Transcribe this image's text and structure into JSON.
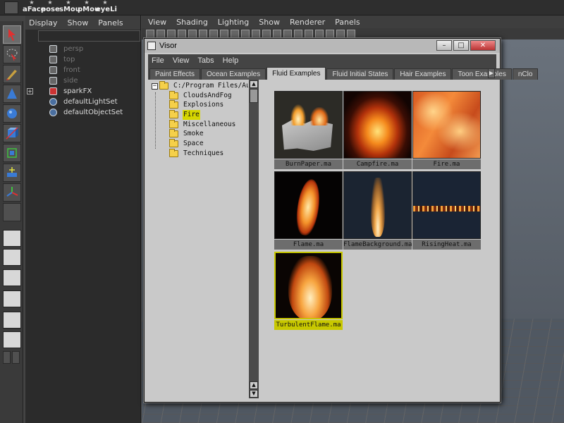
{
  "shelf": {
    "buttons": [
      {
        "label": "aFace",
        "name": "shelf-aface"
      },
      {
        "label": "pose",
        "name": "shelf-pose"
      },
      {
        "label": "sMou",
        "name": "shelf-smou"
      },
      {
        "label": "pMou",
        "name": "shelf-pmou"
      },
      {
        "label": "eyeLi",
        "name": "shelf-eyeli"
      }
    ]
  },
  "outliner": {
    "menu": [
      "Display",
      "Show",
      "Panels"
    ],
    "items": [
      {
        "label": "persp",
        "dim": true,
        "icon": "camera-icon"
      },
      {
        "label": "top",
        "dim": true,
        "icon": "camera-icon"
      },
      {
        "label": "front",
        "dim": true,
        "icon": "camera-icon"
      },
      {
        "label": "side",
        "dim": true,
        "icon": "camera-icon"
      },
      {
        "label": "sparkFX",
        "dim": false,
        "icon": "fx-icon",
        "expand": "+"
      },
      {
        "label": "defaultLightSet",
        "dim": false,
        "icon": "set-icon"
      },
      {
        "label": "defaultObjectSet",
        "dim": false,
        "icon": "set-icon"
      }
    ]
  },
  "viewport": {
    "menu": [
      "View",
      "Shading",
      "Lighting",
      "Show",
      "Renderer",
      "Panels"
    ]
  },
  "visor": {
    "title": "Visor",
    "window_buttons": {
      "minimize": "–",
      "maximize": "□",
      "close": "✕"
    },
    "menu": [
      "File",
      "View",
      "Tabs",
      "Help"
    ],
    "tabs": [
      {
        "label": "Paint Effects",
        "active": false
      },
      {
        "label": "Ocean Examples",
        "active": false
      },
      {
        "label": "Fluid Examples",
        "active": true
      },
      {
        "label": "Fluid Initial States",
        "active": false
      },
      {
        "label": "Hair Examples",
        "active": false
      },
      {
        "label": "Toon Examples",
        "active": false
      },
      {
        "label": "nClo",
        "active": false
      }
    ],
    "tab_scroll": "▶",
    "tree": {
      "root_toggle": "−",
      "root": "C:/Program Files/Au",
      "folders": [
        {
          "label": "CloudsAndFog",
          "selected": false
        },
        {
          "label": "Explosions",
          "selected": false
        },
        {
          "label": "Fire",
          "selected": true
        },
        {
          "label": "Miscellaneous",
          "selected": false
        },
        {
          "label": "Smoke",
          "selected": false
        },
        {
          "label": "Space",
          "selected": false
        },
        {
          "label": "Techniques",
          "selected": false
        }
      ],
      "scroll_up": "▲",
      "scroll_down": "▼"
    },
    "thumbnails": [
      {
        "label": "BurnPaper.ma",
        "art": "burn",
        "selected": false
      },
      {
        "label": "Campfire.ma",
        "art": "campfire",
        "selected": false
      },
      {
        "label": "Fire.ma",
        "art": "fire-tex",
        "selected": false
      },
      {
        "label": "Flame.ma",
        "art": "flame",
        "selected": false
      },
      {
        "label": "FlameBackground.ma",
        "art": "flamebg",
        "selected": false
      },
      {
        "label": "RisingHeat.ma",
        "art": "rising",
        "selected": false
      },
      {
        "label": "TurbulentFlame.ma",
        "art": "turb",
        "selected": true
      }
    ]
  }
}
